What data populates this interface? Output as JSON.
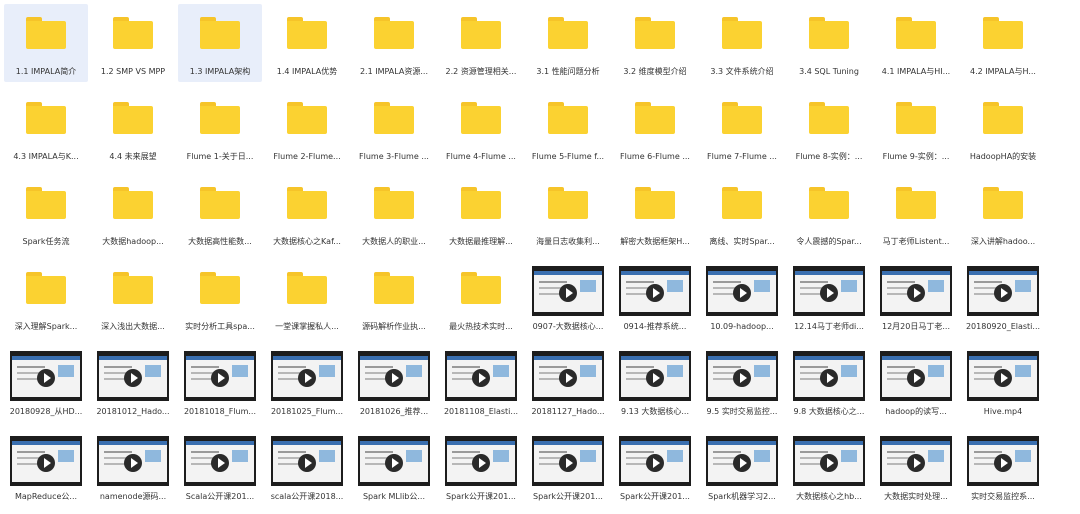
{
  "colors": {
    "folder": "#fbd231",
    "folder_tab": "#f6c429",
    "selected_bg": "#e8eefa",
    "video_frame": "#1d1d1d"
  },
  "items": [
    {
      "label": "1.1 IMPALA简介",
      "type": "folder",
      "selected": true
    },
    {
      "label": "1.2 SMP VS MPP",
      "type": "folder"
    },
    {
      "label": "1.3 IMPALA架构",
      "type": "folder",
      "selected": true
    },
    {
      "label": "1.4 IMPALA优势",
      "type": "folder"
    },
    {
      "label": "2.1 IMPALA资源...",
      "type": "folder"
    },
    {
      "label": "2.2 资源管理相关...",
      "type": "folder"
    },
    {
      "label": "3.1 性能问题分析",
      "type": "folder"
    },
    {
      "label": "3.2 维度模型介绍",
      "type": "folder"
    },
    {
      "label": "3.3 文件系统介绍",
      "type": "folder"
    },
    {
      "label": "3.4 SQL Tuning",
      "type": "folder"
    },
    {
      "label": "4.1 IMPALA与HI...",
      "type": "folder"
    },
    {
      "label": "4.2 IMPALA与H...",
      "type": "folder"
    },
    {
      "label": "4.3 IMPALA与K...",
      "type": "folder"
    },
    {
      "label": "4.4 未来展望",
      "type": "folder"
    },
    {
      "label": "Flume 1-关于日...",
      "type": "folder"
    },
    {
      "label": "Flume 2-Flume...",
      "type": "folder"
    },
    {
      "label": "Flume 3-Flume ...",
      "type": "folder"
    },
    {
      "label": "Flume 4-Flume ...",
      "type": "folder"
    },
    {
      "label": "Flume 5-Flume f...",
      "type": "folder"
    },
    {
      "label": "Flume 6-Flume ...",
      "type": "folder"
    },
    {
      "label": "Flume 7-Flume ...",
      "type": "folder"
    },
    {
      "label": "Flume 8-实例：...",
      "type": "folder"
    },
    {
      "label": "Flume 9-实例：...",
      "type": "folder"
    },
    {
      "label": "HadoopHA的安装",
      "type": "folder"
    },
    {
      "label": "Spark任务流",
      "type": "folder"
    },
    {
      "label": "大数据hadoop...",
      "type": "folder"
    },
    {
      "label": "大数据高性能数...",
      "type": "folder"
    },
    {
      "label": "大数据核心之Kaf...",
      "type": "folder"
    },
    {
      "label": "大数据人的职业...",
      "type": "folder"
    },
    {
      "label": "大数据最推理解...",
      "type": "folder"
    },
    {
      "label": "海量日志收集利...",
      "type": "folder"
    },
    {
      "label": "解密大数据框架H...",
      "type": "folder"
    },
    {
      "label": "离线、实时Spar...",
      "type": "folder"
    },
    {
      "label": "令人震撼的Spar...",
      "type": "folder"
    },
    {
      "label": "马丁老师Listent...",
      "type": "folder"
    },
    {
      "label": "深入讲解hadoo...",
      "type": "folder"
    },
    {
      "label": "深入理解Spark...",
      "type": "folder"
    },
    {
      "label": "深入浅出大数据...",
      "type": "folder"
    },
    {
      "label": "实时分析工具spa...",
      "type": "folder"
    },
    {
      "label": "一堂课掌握私人...",
      "type": "folder"
    },
    {
      "label": "源码解析作业执...",
      "type": "folder"
    },
    {
      "label": "最火热技术实时...",
      "type": "folder"
    },
    {
      "label": "0907-大数据核心...",
      "type": "video"
    },
    {
      "label": "0914-推荐系统...",
      "type": "video"
    },
    {
      "label": "10.09-hadoop...",
      "type": "video"
    },
    {
      "label": "12.14马丁老师di...",
      "type": "video"
    },
    {
      "label": "12月20日马丁老...",
      "type": "video"
    },
    {
      "label": "20180920_Elasti...",
      "type": "video"
    },
    {
      "label": "20180928_从HD...",
      "type": "video"
    },
    {
      "label": "20181012_Hado...",
      "type": "video"
    },
    {
      "label": "20181018_Flum...",
      "type": "video"
    },
    {
      "label": "20181025_Flum...",
      "type": "video"
    },
    {
      "label": "20181026_推荐...",
      "type": "video"
    },
    {
      "label": "20181108_Elasti...",
      "type": "video"
    },
    {
      "label": "20181127_Hado...",
      "type": "video"
    },
    {
      "label": "9.13 大数据核心...",
      "type": "video"
    },
    {
      "label": "9.5 实时交易监控...",
      "type": "video"
    },
    {
      "label": "9.8 大数据核心之...",
      "type": "video"
    },
    {
      "label": "hadoop的读写...",
      "type": "video"
    },
    {
      "label": "Hive.mp4",
      "type": "video"
    },
    {
      "label": "MapReduce公...",
      "type": "video"
    },
    {
      "label": "namenode源码...",
      "type": "video"
    },
    {
      "label": "Scala公开课201...",
      "type": "video"
    },
    {
      "label": "scala公开课2018...",
      "type": "video"
    },
    {
      "label": "Spark MLlib公...",
      "type": "video"
    },
    {
      "label": "Spark公开课201...",
      "type": "video"
    },
    {
      "label": "Spark公开课201...",
      "type": "video"
    },
    {
      "label": "Spark公开课201...",
      "type": "video"
    },
    {
      "label": "Spark机器学习2...",
      "type": "video"
    },
    {
      "label": "大数据核心之hb...",
      "type": "video"
    },
    {
      "label": "大数据实时处理...",
      "type": "video"
    },
    {
      "label": "实时交易监控系...",
      "type": "video"
    }
  ]
}
